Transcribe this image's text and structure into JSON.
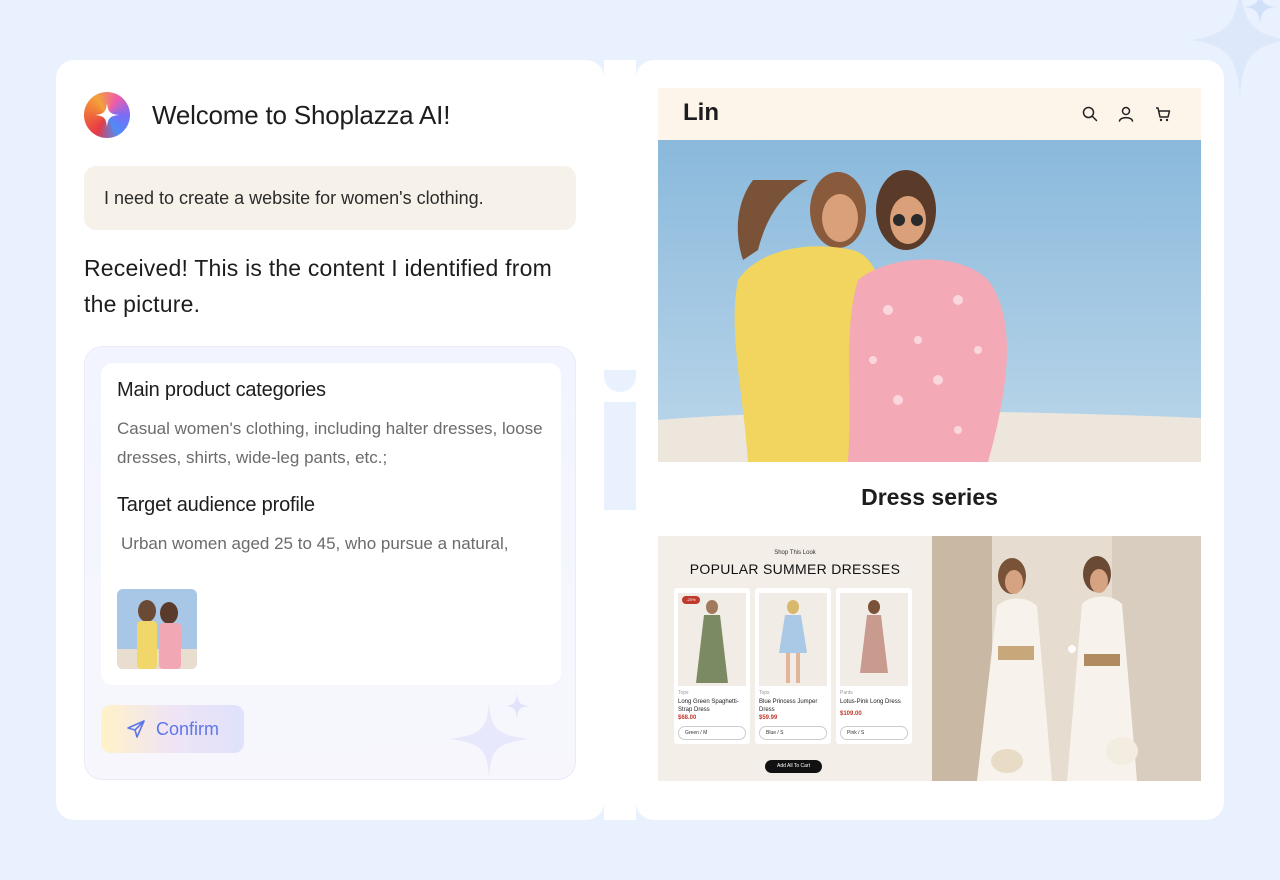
{
  "chat": {
    "welcome": "Welcome to Shoplazza AI!",
    "user_message": "I need to create a website for women's clothing.",
    "ai_response": "Received! This is the content I identified from the picture.",
    "sections": [
      {
        "title": "Main product categories",
        "text": "Casual women's clothing, including halter dresses, loose dresses, shirts, wide-leg pants, etc.;"
      },
      {
        "title": "Target audience profile",
        "text": "Urban women aged 25 to 45, who pursue a natural,"
      }
    ],
    "confirm_label": "Confirm"
  },
  "preview": {
    "brand": "Lin",
    "header_icons": [
      "search-icon",
      "user-icon",
      "cart-icon"
    ],
    "series_title": "Dress series",
    "banner": {
      "kicker": "Shop This Look",
      "title": "POPULAR SUMMER DRESSES",
      "add_all_label": "Add All To Cart",
      "products": [
        {
          "badge": "-20%",
          "category": "Tops",
          "name": "Long Green Spaghetti-Strap Dress",
          "price": "$68.00",
          "option": "Green / M"
        },
        {
          "badge": "",
          "category": "Tops",
          "name": "Blue Princess Jumper Dress",
          "price": "$59.99",
          "option": "Blue / S"
        },
        {
          "badge": "",
          "category": "Pants",
          "name": "Lotus-Pink Long Dress",
          "price": "$109.00",
          "option": "Pink / S"
        }
      ]
    }
  },
  "colors": {
    "background": "#e8f1fd",
    "accent": "#5f76e8",
    "price": "#c0392b",
    "header_bg": "#fdf4ea"
  }
}
